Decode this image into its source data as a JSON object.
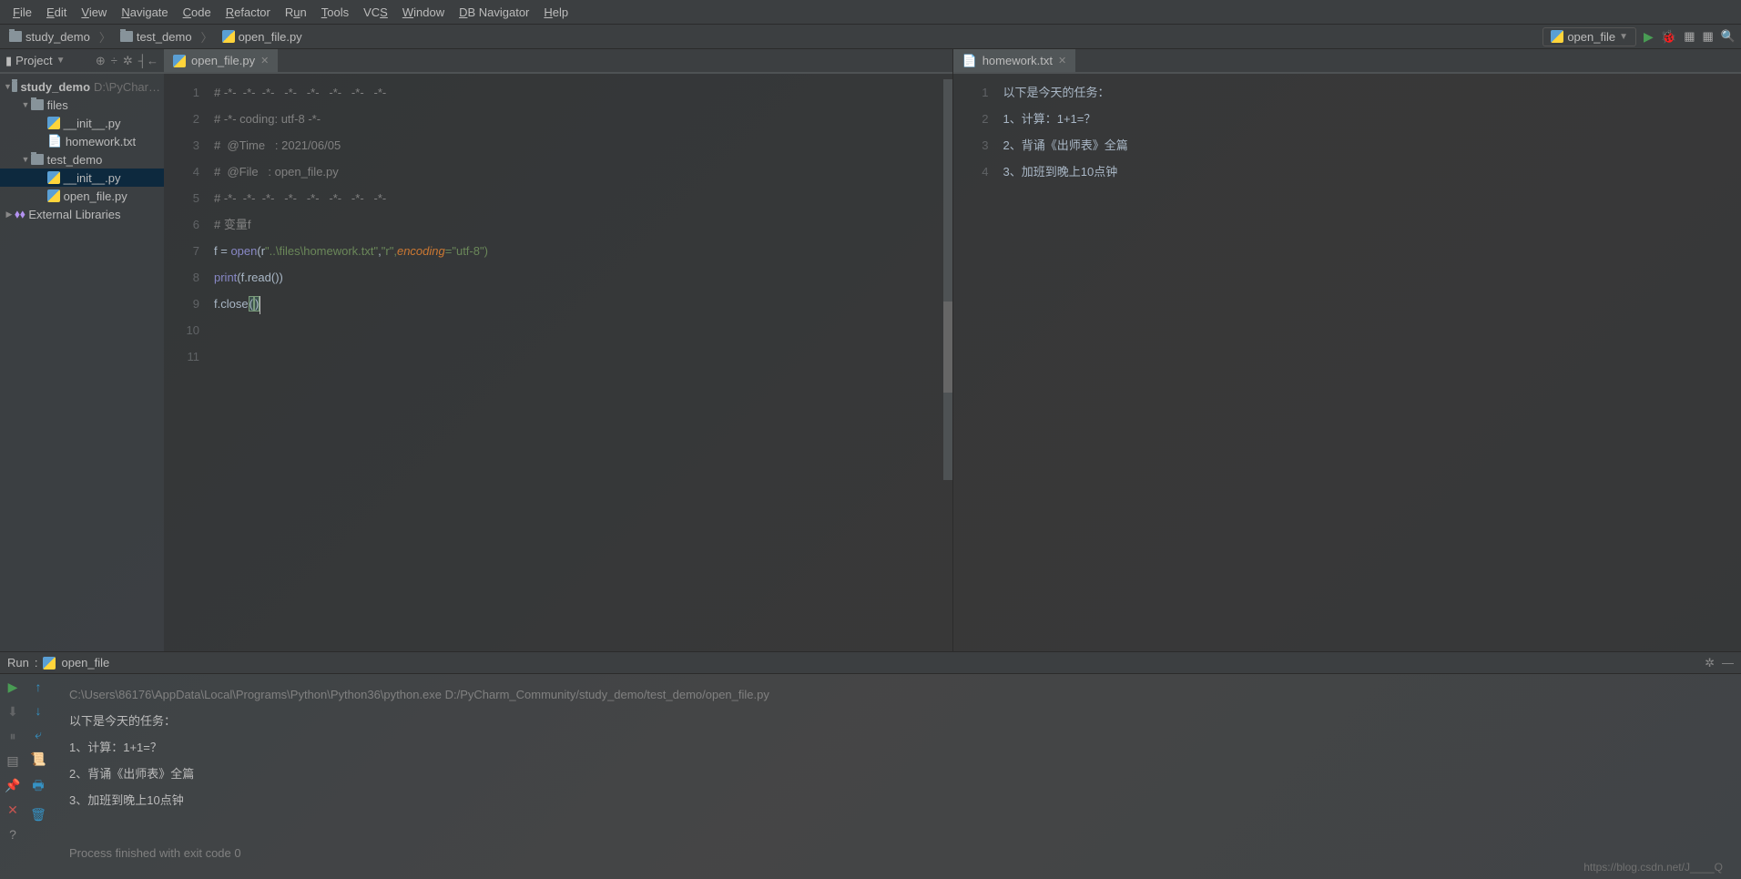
{
  "menu": [
    "File",
    "Edit",
    "View",
    "Navigate",
    "Code",
    "Refactor",
    "Run",
    "Tools",
    "VCS",
    "Window",
    "DB Navigator",
    "Help"
  ],
  "breadcrumbs": [
    {
      "type": "folder",
      "label": "study_demo"
    },
    {
      "type": "folder",
      "label": "test_demo"
    },
    {
      "type": "py",
      "label": "open_file.py"
    }
  ],
  "run_config": {
    "name": "open_file"
  },
  "sidebar": {
    "title": "Project",
    "tree": {
      "root": {
        "name": "study_demo",
        "path": "D:\\PyChar…"
      },
      "files_folder": "files",
      "files_children": [
        "__init__.py",
        "homework.txt"
      ],
      "testdemo": "test_demo",
      "testdemo_children": [
        "__init__.py",
        "open_file.py"
      ],
      "ext_lib": "External Libraries"
    }
  },
  "tabs": {
    "left": "open_file.py",
    "right": "homework.txt"
  },
  "editor_left": {
    "lines": [
      "# -*-  -*-  -*-   -*-   -*-   -*-   -*-   -*-",
      "# -*- coding: utf-8 -*-",
      "#  @Time   : 2021/06/05",
      "#  @File   : open_file.py",
      "# -*-  -*-  -*-   -*-   -*-   -*-   -*-   -*-",
      "# 变量f",
      "f = open(r\"..\\files\\homework.txt\",\"r\",encoding=\"utf-8\")",
      "print(f.read())",
      "f.close()",
      "",
      ""
    ],
    "line_count": 11
  },
  "editor_right": {
    "lines": [
      "以下是今天的任务：",
      "1、计算：1+1=？",
      "2、背诵《出师表》全篇",
      "3、加班到晚上10点钟"
    ],
    "line_count": 4
  },
  "run_panel": {
    "tab_label": "Run",
    "config_label": "open_file",
    "console": [
      "C:\\Users\\86176\\AppData\\Local\\Programs\\Python\\Python36\\python.exe D:/PyCharm_Community/study_demo/test_demo/open_file.py",
      "以下是今天的任务：",
      "1、计算：1+1=？",
      "2、背诵《出师表》全篇",
      "3、加班到晚上10点钟",
      "",
      "Process finished with exit code 0"
    ]
  },
  "watermark": "https://blog.csdn.net/J____Q"
}
